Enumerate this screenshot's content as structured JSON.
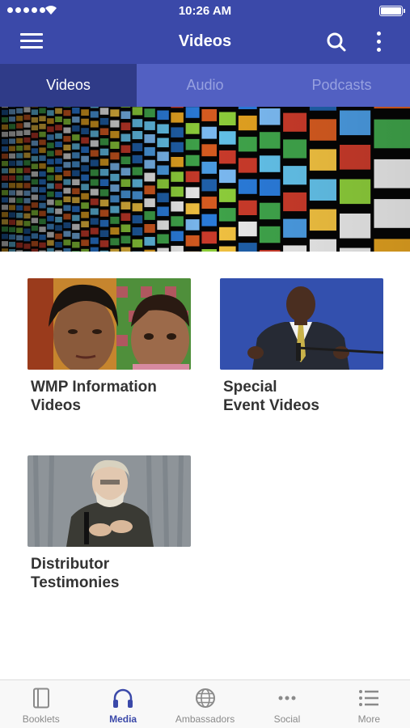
{
  "status_bar": {
    "time": "10:26 AM"
  },
  "app_bar": {
    "title": "Videos"
  },
  "tabs": [
    {
      "label": "Videos",
      "active": true
    },
    {
      "label": "Audio",
      "active": false
    },
    {
      "label": "Podcasts",
      "active": false
    }
  ],
  "cards": [
    {
      "line1": "WMP Information",
      "line2": "Videos"
    },
    {
      "line1": "Special",
      "line2": "Event Videos"
    },
    {
      "line1": "Distributor",
      "line2": "Testimonies"
    }
  ],
  "bottom_nav": [
    {
      "label": "Booklets",
      "icon": "booklet-icon",
      "active": false
    },
    {
      "label": "Media",
      "icon": "headphones-icon",
      "active": true
    },
    {
      "label": "Ambassadors",
      "icon": "globe-icon",
      "active": false
    },
    {
      "label": "Social",
      "icon": "ellipsis-icon",
      "active": false
    },
    {
      "label": "More",
      "icon": "list-icon",
      "active": false
    }
  ],
  "colors": {
    "brand": "#3b49a9",
    "tab_active": "#2f3b88",
    "tab_bar": "#5260c2"
  }
}
